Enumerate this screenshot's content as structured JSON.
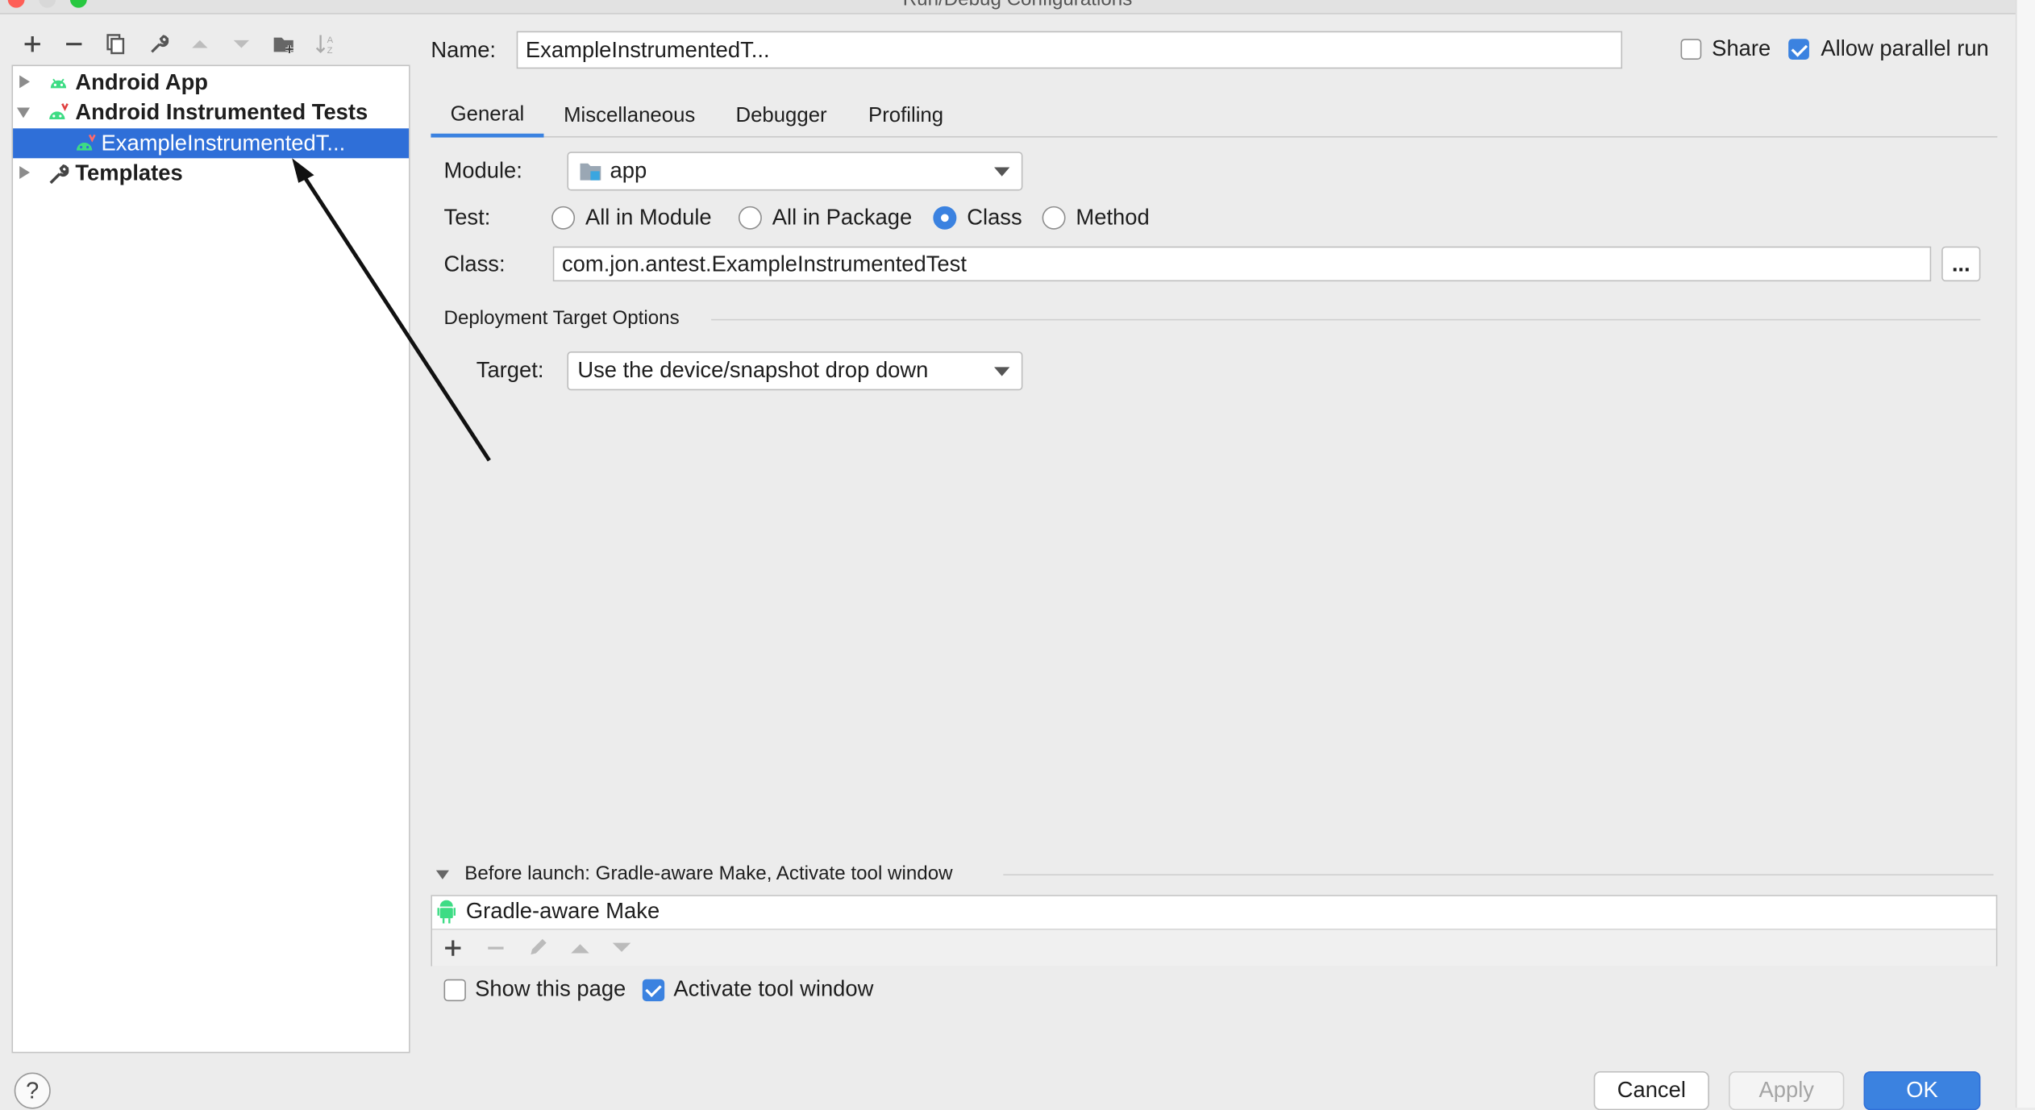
{
  "window": {
    "title": "Run/Debug Configurations"
  },
  "toolbar": {
    "buttons": [
      {
        "name": "add-icon"
      },
      {
        "name": "remove-icon"
      },
      {
        "name": "copy-icon"
      },
      {
        "name": "wrench-icon"
      },
      {
        "name": "move-up-icon"
      },
      {
        "name": "move-down-icon"
      },
      {
        "name": "new-folder-icon"
      },
      {
        "name": "sort-icon"
      }
    ]
  },
  "tree": {
    "items": [
      {
        "label": "Android App",
        "expanded": false,
        "icon": "android-icon"
      },
      {
        "label": "Android Instrumented Tests",
        "expanded": true,
        "icon": "android-test-icon"
      },
      {
        "label": "ExampleInstrumentedT...",
        "selected": true,
        "icon": "android-test-icon"
      },
      {
        "label": "Templates",
        "expanded": false,
        "icon": "wrench-icon"
      }
    ]
  },
  "header": {
    "name_label": "Name:",
    "name_value": "ExampleInstrumentedT...",
    "share_label": "Share",
    "share_checked": false,
    "parallel_label": "Allow parallel run",
    "parallel_checked": true
  },
  "tabs": [
    {
      "label": "General",
      "active": true
    },
    {
      "label": "Miscellaneous",
      "active": false
    },
    {
      "label": "Debugger",
      "active": false
    },
    {
      "label": "Profiling",
      "active": false
    }
  ],
  "form": {
    "module_label": "Module:",
    "module_value": "app",
    "test_label": "Test:",
    "test_options": [
      "All in Module",
      "All in Package",
      "Class",
      "Method"
    ],
    "test_selected": "Class",
    "class_label": "Class:",
    "class_value": "com.jon.antest.ExampleInstrumentedTest",
    "browse_label": "...",
    "deploy_section": "Deployment Target Options",
    "target_label": "Target:",
    "target_value": "Use the device/snapshot drop down"
  },
  "before_launch": {
    "title": "Before launch: Gradle-aware Make, Activate tool window",
    "tasks": [
      "Gradle-aware Make"
    ],
    "show_page_label": "Show this page",
    "show_page_checked": false,
    "activate_label": "Activate tool window",
    "activate_checked": true
  },
  "footer": {
    "help": "?",
    "cancel": "Cancel",
    "apply": "Apply",
    "ok": "OK"
  },
  "colors": {
    "accent": "#3b82e0",
    "selection": "#2f6fd8",
    "android_green": "#3ddc84"
  }
}
